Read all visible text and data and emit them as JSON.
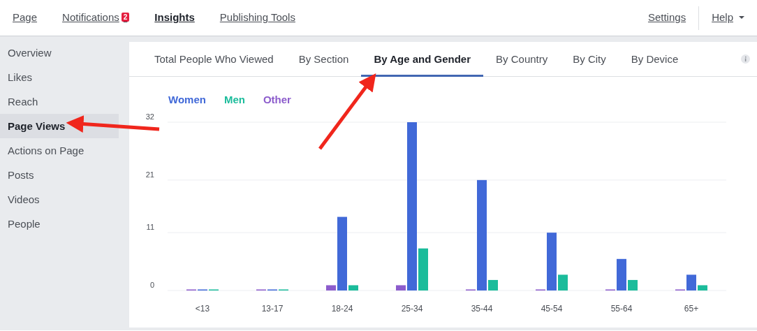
{
  "top_nav": {
    "items": [
      {
        "label": "Page",
        "selected": false
      },
      {
        "label": "Notifications",
        "selected": false,
        "badge": "2"
      },
      {
        "label": "Insights",
        "selected": true
      },
      {
        "label": "Publishing Tools",
        "selected": false
      }
    ],
    "right": [
      {
        "label": "Settings"
      },
      {
        "label": "Help",
        "kind": "dropdown"
      }
    ]
  },
  "sidebar": {
    "items": [
      {
        "label": "Overview",
        "selected": false
      },
      {
        "label": "Likes",
        "selected": false
      },
      {
        "label": "Reach",
        "selected": false
      },
      {
        "label": "Page Views",
        "selected": true
      },
      {
        "label": "Actions on Page",
        "selected": false
      },
      {
        "label": "Posts",
        "selected": false
      },
      {
        "label": "Videos",
        "selected": false
      },
      {
        "label": "People",
        "selected": false
      }
    ]
  },
  "tabs": [
    {
      "label": "Total People Who Viewed",
      "selected": false
    },
    {
      "label": "By Section",
      "selected": false
    },
    {
      "label": "By Age and Gender",
      "selected": true
    },
    {
      "label": "By Country",
      "selected": false
    },
    {
      "label": "By City",
      "selected": false
    },
    {
      "label": "By Device",
      "selected": false
    }
  ],
  "chart": {
    "chart_data": {
      "type": "bar",
      "categories": [
        "<13",
        "13-17",
        "18-24",
        "25-34",
        "35-44",
        "45-54",
        "55-64",
        "65+"
      ],
      "ylim": [
        0,
        32
      ],
      "yticks": [
        0,
        11,
        21,
        32
      ],
      "series": [
        {
          "name": "Other",
          "color": "#8c5ccc",
          "values": [
            0,
            0,
            1,
            1,
            0,
            0,
            0,
            0
          ]
        },
        {
          "name": "Women",
          "color": "#4169d8",
          "values": [
            0,
            0,
            14,
            32,
            21,
            11,
            6,
            3
          ]
        },
        {
          "name": "Men",
          "color": "#1bbc9b",
          "values": [
            0,
            0,
            1,
            8,
            2,
            3,
            2,
            1
          ]
        }
      ]
    }
  }
}
